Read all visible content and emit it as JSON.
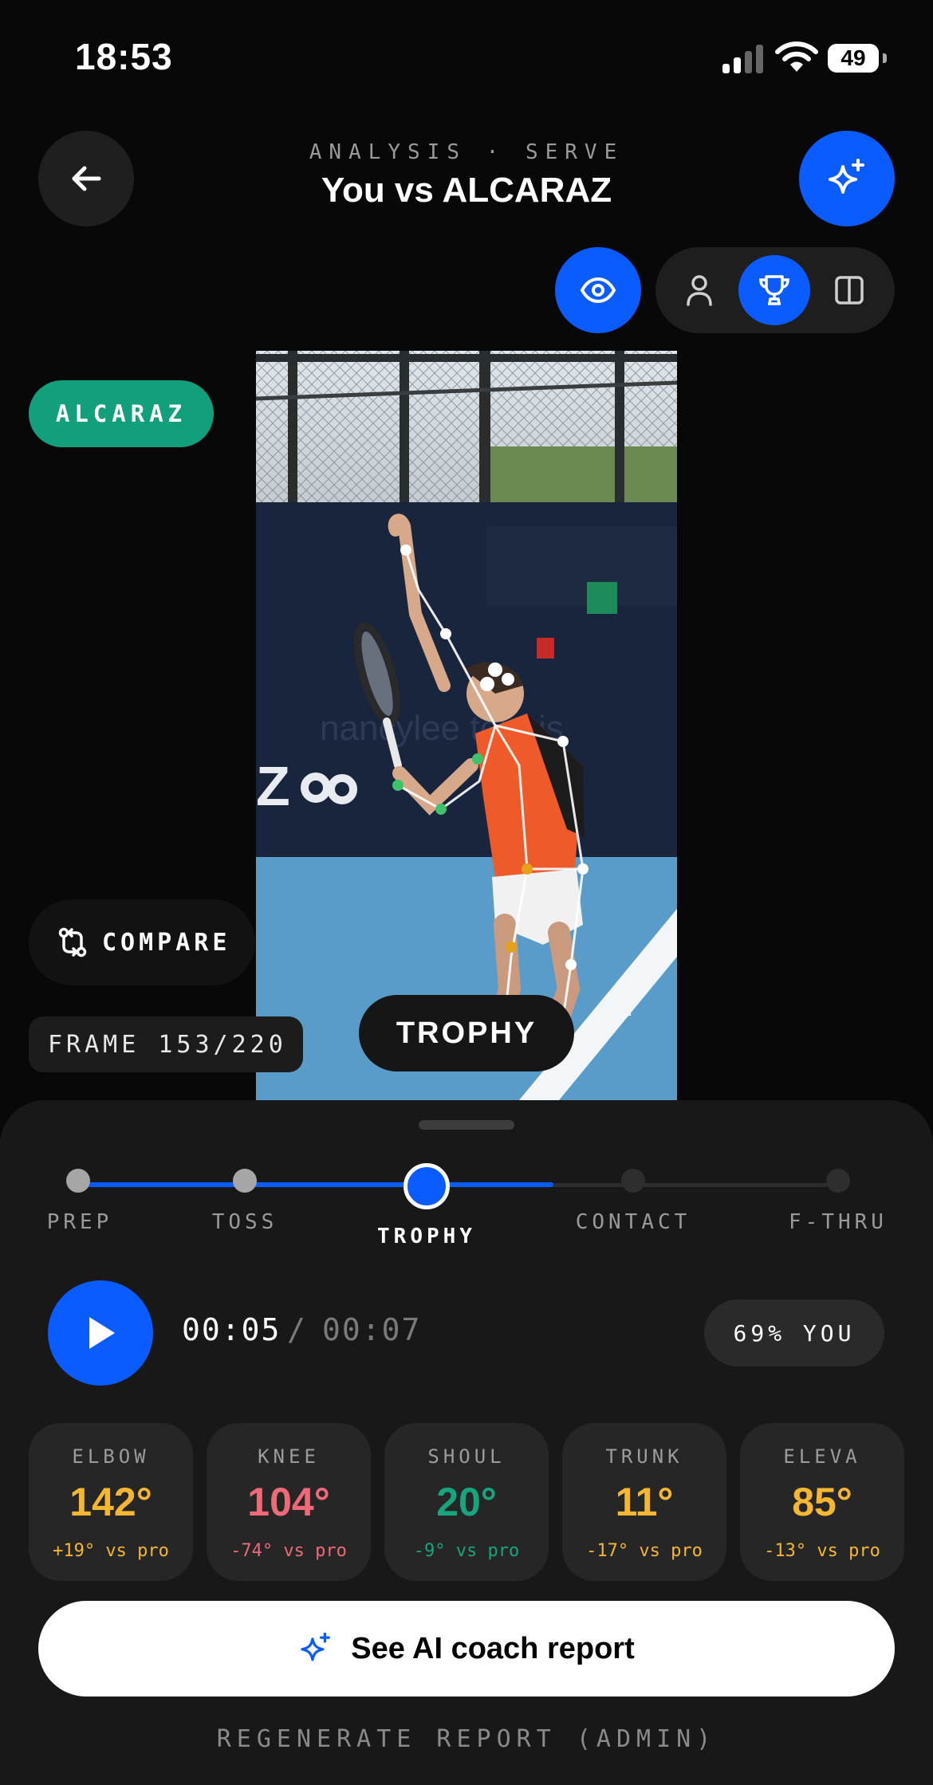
{
  "status_bar": {
    "time": "18:53",
    "battery": "49"
  },
  "header": {
    "kicker": "ANALYSIS · SERVE",
    "title": "You vs ALCARAZ",
    "back_icon": "arrow-left-icon",
    "ai_icon": "sparkles-icon"
  },
  "view_controls": {
    "overlay_icon": "eye-icon",
    "modes": [
      {
        "icon": "person-icon",
        "active": false
      },
      {
        "icon": "trophy-icon",
        "active": true
      },
      {
        "icon": "split-view-icon",
        "active": false
      }
    ]
  },
  "video": {
    "player_badge": "ALCARAZ",
    "watermark": "nancylee tennis",
    "frame_label": "FRAME 153/220",
    "phase_pill": "TROPHY"
  },
  "compare_button": {
    "label": "COMPARE",
    "icon": "swap-icon"
  },
  "phases": [
    {
      "label": "PREP",
      "state": "done"
    },
    {
      "label": "TOSS",
      "state": "done"
    },
    {
      "label": "TROPHY",
      "state": "current"
    },
    {
      "label": "CONTACT",
      "state": "todo"
    },
    {
      "label": "F-THRU",
      "state": "todo"
    }
  ],
  "playback": {
    "current": "00:05",
    "separator": "/",
    "total": "00:07",
    "match": "69% YOU",
    "progress": 0.63
  },
  "metrics": [
    {
      "label": "ELBOW",
      "value": "142°",
      "delta": "+19° vs pro",
      "color": "#f5b731"
    },
    {
      "label": "KNEE",
      "value": "104°",
      "delta": "-74° vs pro",
      "color": "#ef6a78"
    },
    {
      "label": "SHOUL",
      "value": "20°",
      "delta": "-9° vs pro",
      "color": "#16a57e"
    },
    {
      "label": "TRUNK",
      "value": "11°",
      "delta": "-17° vs pro",
      "color": "#f5b731"
    },
    {
      "label": "ELEVA",
      "value": "85°",
      "delta": "-13° vs pro",
      "color": "#f5b731"
    }
  ],
  "report_button": {
    "label": "See AI coach report",
    "icon": "sparkles-icon"
  },
  "admin_link": "REGENERATE REPORT (ADMIN)",
  "colors": {
    "accent": "#0a5cff",
    "pro_badge": "#12a07c",
    "background": "#080808",
    "sheet": "#181818"
  }
}
